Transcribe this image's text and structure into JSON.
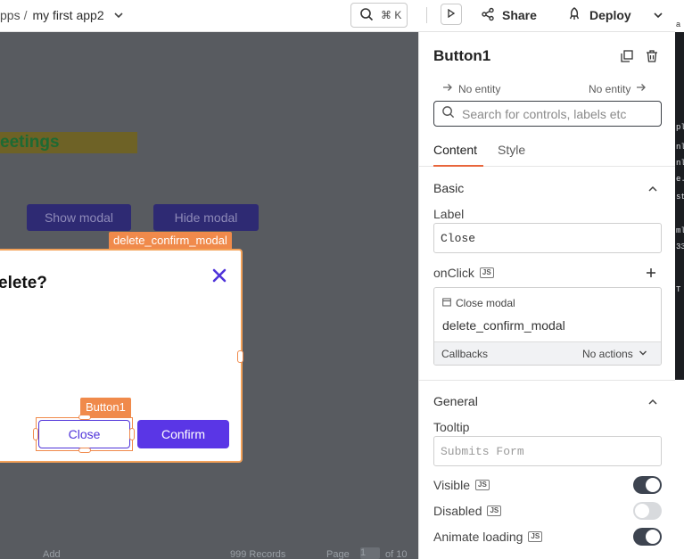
{
  "header": {
    "breadcrumb_parent": "pps",
    "breadcrumb_sep": "/",
    "app_name": "my first app2",
    "search_shortcut": "⌘ K",
    "share_label": "Share",
    "deploy_label": "Deploy"
  },
  "canvas": {
    "greeting_text": "eetings",
    "show_modal_label": "Show modal",
    "hide_modal_label": "Hide modal",
    "modal_tag": "delete_confirm_modal",
    "modal_title": "elete?",
    "button_tag": "Button1",
    "close_label": "Close",
    "confirm_label": "Confirm",
    "footer_add": "Add",
    "footer_records": "999 Records",
    "footer_page": "Page",
    "footer_page_num": "1",
    "footer_of": "of 10"
  },
  "panel": {
    "title": "Button1",
    "entity_left": "No entity",
    "entity_right": "No entity",
    "search_placeholder": "Search for controls, labels etc",
    "tabs": [
      "Content",
      "Style"
    ],
    "active_tab": "Content",
    "basic": {
      "title": "Basic",
      "label_title": "Label",
      "label_value": "Close",
      "onclick_title": "onClick",
      "js_badge": "JS",
      "action_type": "Close modal",
      "action_value": "delete_confirm_modal",
      "callbacks_label": "Callbacks",
      "callbacks_value": "No actions"
    },
    "general": {
      "title": "General",
      "tooltip_title": "Tooltip",
      "tooltip_placeholder": "Submits Form",
      "visible_label": "Visible",
      "visible": true,
      "disabled_label": "Disabled",
      "disabled": false,
      "animate_label": "Animate loading",
      "animate": true
    }
  },
  "strip": {
    "top_char": "a",
    "lines": [
      "pli",
      "nl",
      "nl",
      "e.",
      "st",
      "ml",
      "33"
    ],
    "tab_char": "T"
  },
  "colors": {
    "accent": "#5a36e6",
    "selection": "#f08a4b",
    "canvas_bg": "#585b60",
    "tab_underline": "#e8663c",
    "toggle_on": "#3d4450"
  },
  "icons": [
    "chevron-down-icon",
    "search-icon",
    "play-icon",
    "share-icon",
    "rocket-icon",
    "copy-icon",
    "trash-icon",
    "arrow-right-icon",
    "close-x-icon",
    "plus-icon",
    "chevron-up-icon",
    "modal-icon"
  ]
}
